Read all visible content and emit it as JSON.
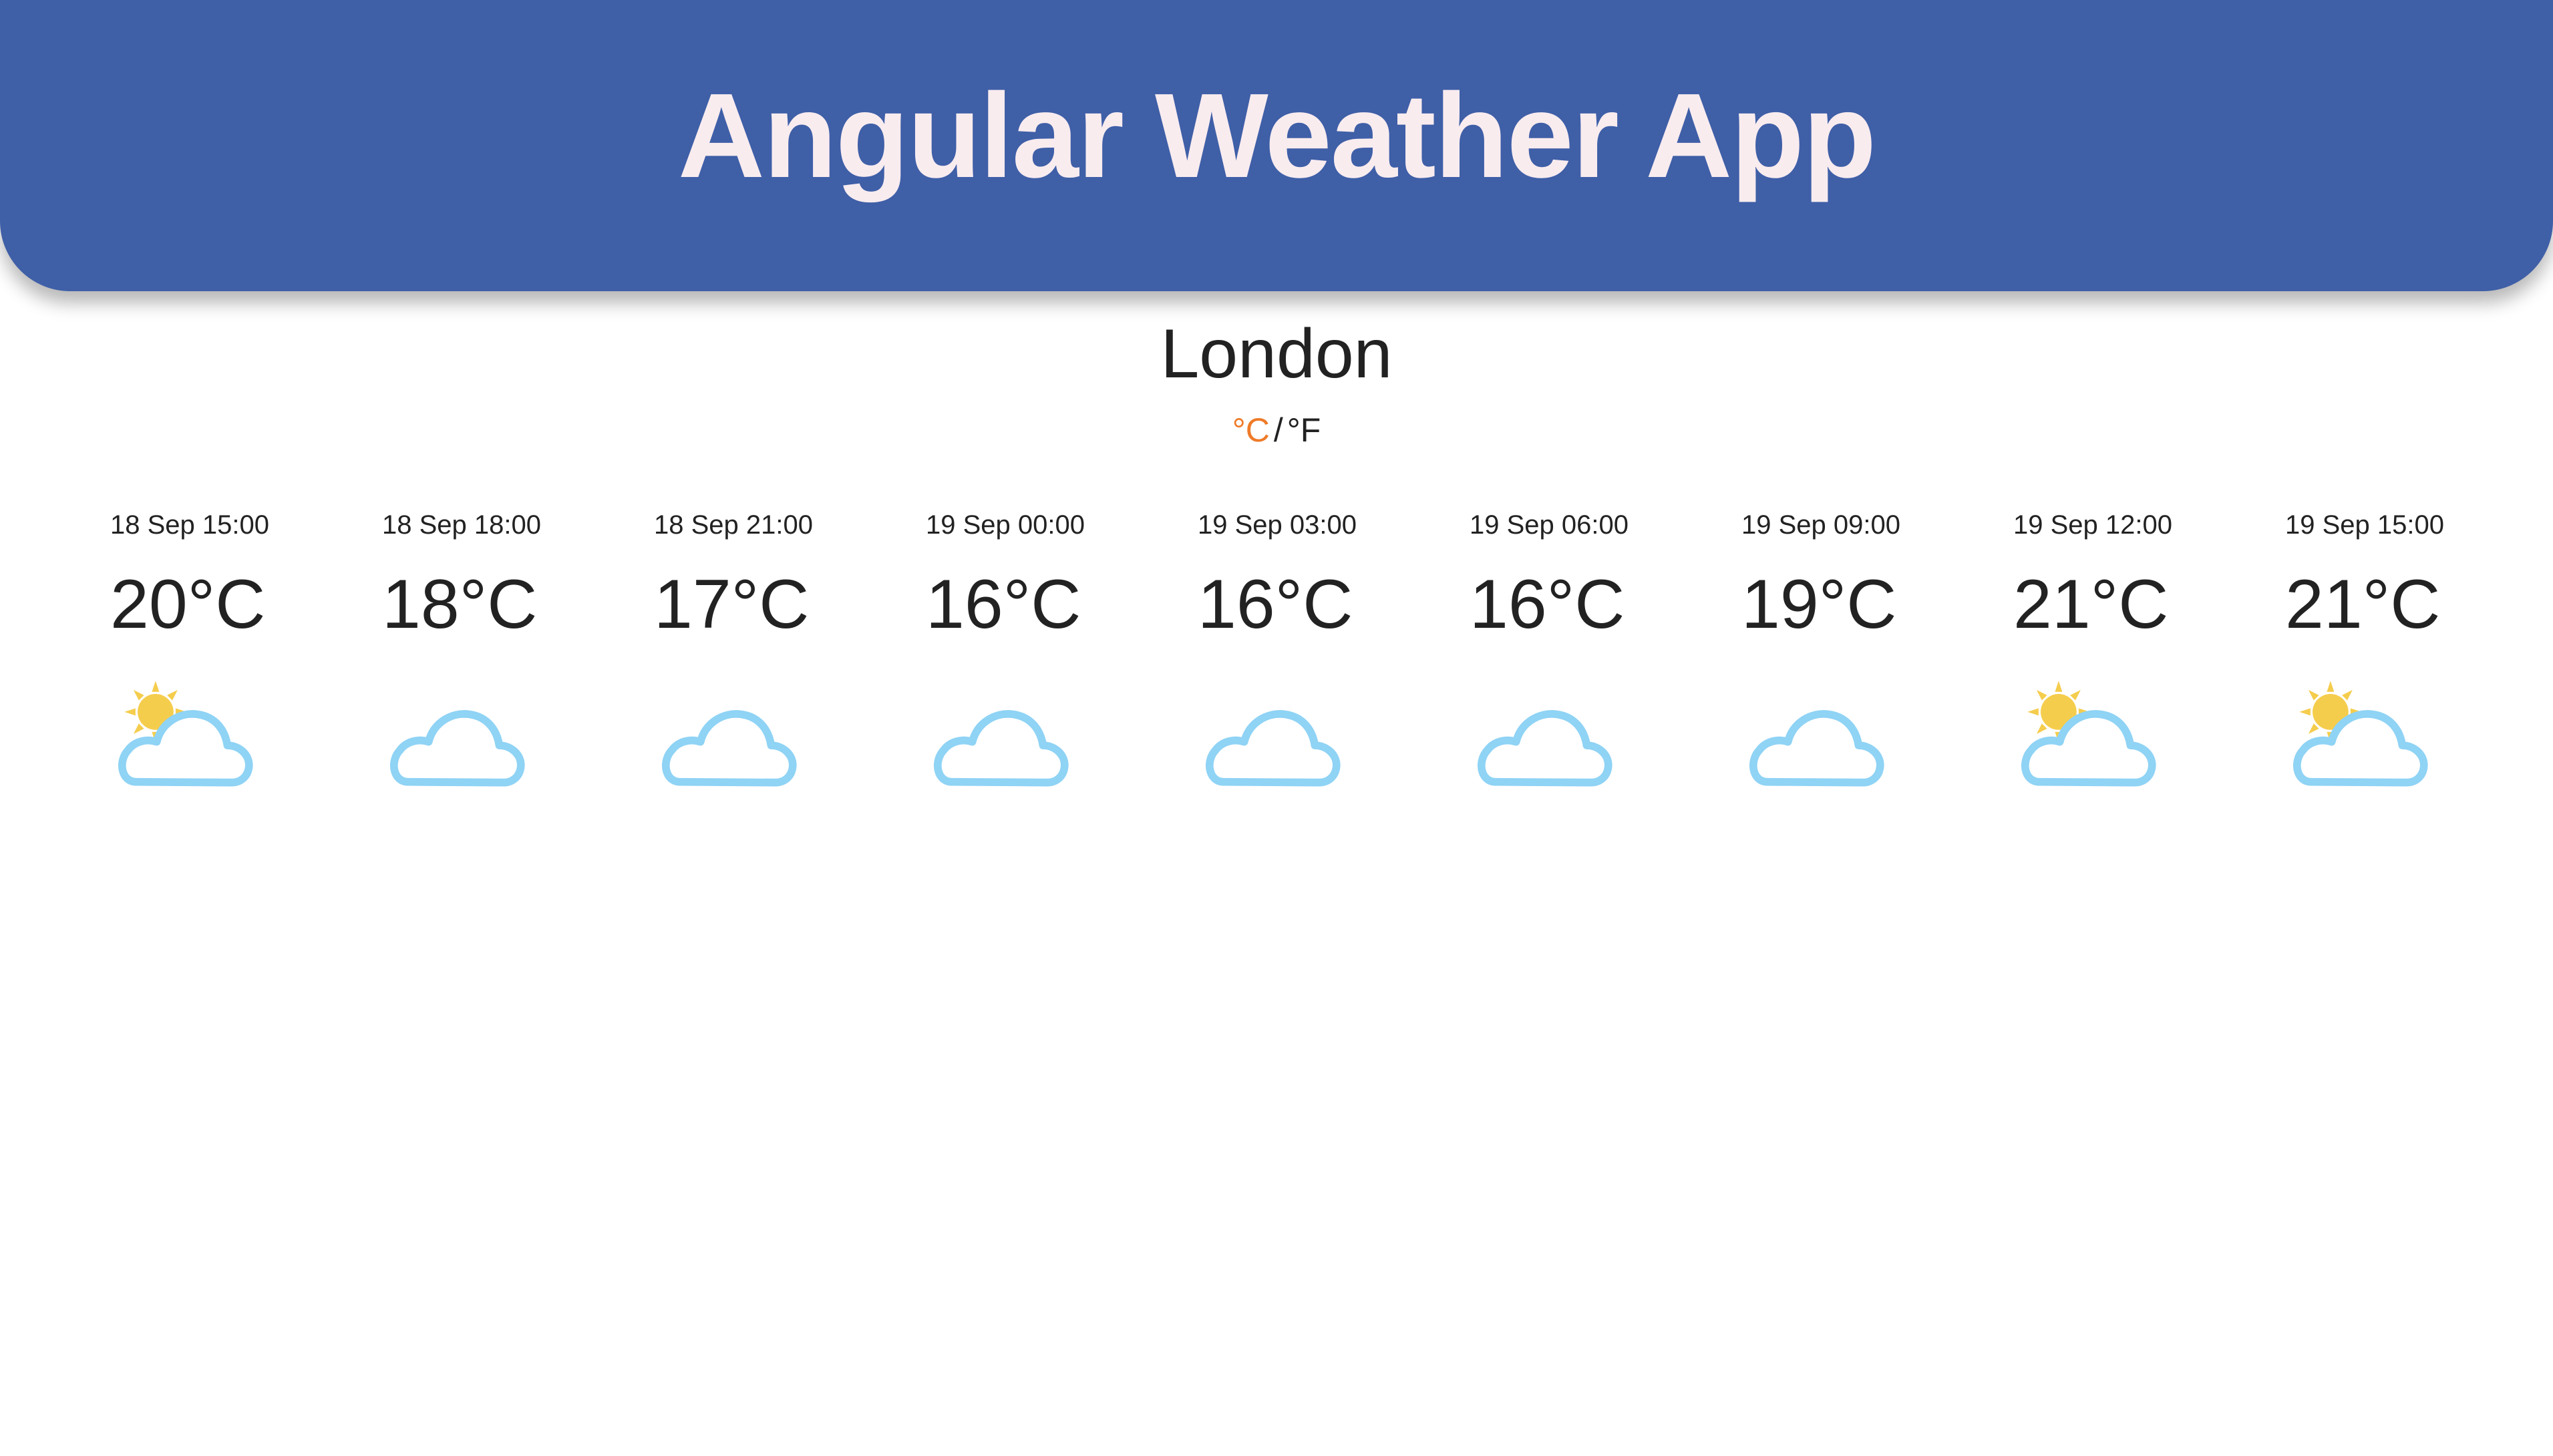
{
  "header": {
    "title": "Angular Weather App"
  },
  "location": {
    "city": "London"
  },
  "units": {
    "celsius_label": "°C",
    "separator": "/",
    "fahrenheit_label": "°F",
    "selected": "°C",
    "selected_color": "#ef7a28"
  },
  "colors": {
    "header_bg": "#3f5fa7",
    "header_text": "#f9ecef",
    "cloud_stroke": "#8fd3f5",
    "sun": "#f5cd4d"
  },
  "forecast": [
    {
      "time": "18 Sep 15:00",
      "temp": "20°C",
      "icon": "partly-cloudy-icon"
    },
    {
      "time": "18 Sep 18:00",
      "temp": "18°C",
      "icon": "cloud-icon"
    },
    {
      "time": "18 Sep 21:00",
      "temp": "17°C",
      "icon": "cloud-icon"
    },
    {
      "time": "19 Sep 00:00",
      "temp": "16°C",
      "icon": "cloud-icon"
    },
    {
      "time": "19 Sep 03:00",
      "temp": "16°C",
      "icon": "cloud-icon"
    },
    {
      "time": "19 Sep 06:00",
      "temp": "16°C",
      "icon": "cloud-icon"
    },
    {
      "time": "19 Sep 09:00",
      "temp": "19°C",
      "icon": "cloud-icon"
    },
    {
      "time": "19 Sep 12:00",
      "temp": "21°C",
      "icon": "partly-cloudy-icon"
    },
    {
      "time": "19 Sep 15:00",
      "temp": "21°C",
      "icon": "partly-cloudy-icon"
    }
  ]
}
